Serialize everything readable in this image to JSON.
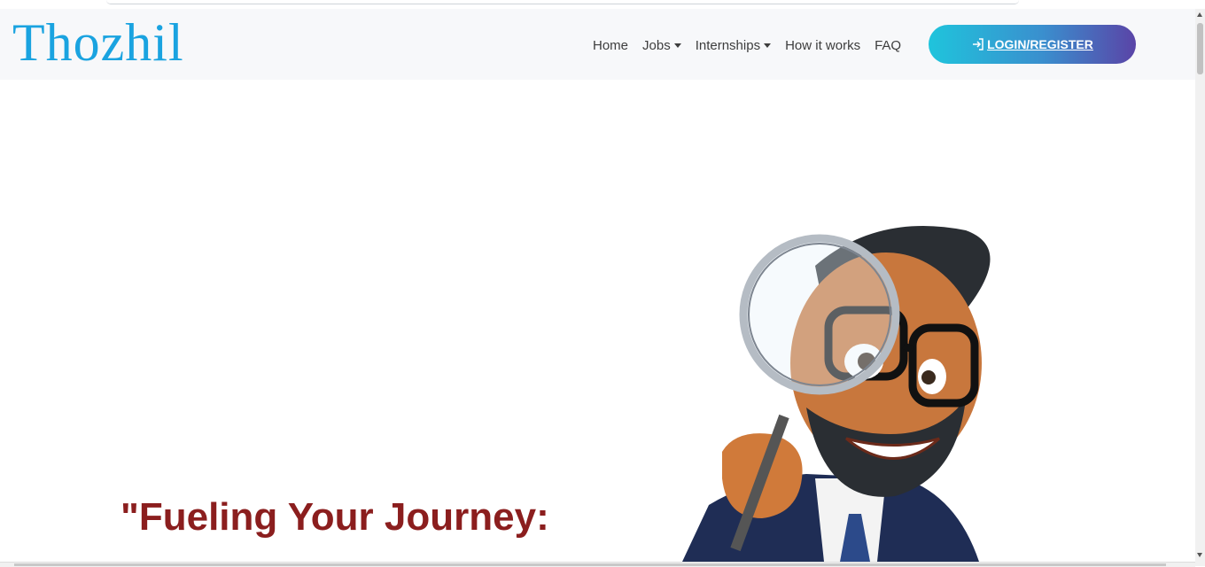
{
  "brand": {
    "logo_text": "Thozhil"
  },
  "nav": {
    "items": [
      {
        "label": "Home",
        "has_dropdown": false
      },
      {
        "label": "Jobs",
        "has_dropdown": true
      },
      {
        "label": "Internships",
        "has_dropdown": true
      },
      {
        "label": "How it works",
        "has_dropdown": false
      },
      {
        "label": "FAQ",
        "has_dropdown": false
      }
    ],
    "login_label": "LOGIN/REGISTER",
    "login_icon": "sign-in-icon"
  },
  "hero": {
    "heading": "\"Fueling Your Journey:",
    "illustration": "cartoon-man-with-magnifying-glass"
  },
  "colors": {
    "brand_blue": "#1aa3e0",
    "heading_red": "#8b1e1e",
    "button_gradient_start": "#1fc4dc",
    "button_gradient_end": "#5a44a7"
  }
}
